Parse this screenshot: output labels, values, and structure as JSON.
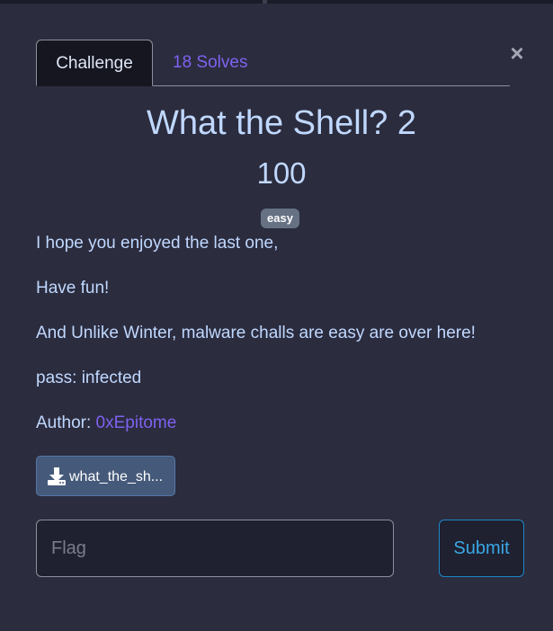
{
  "modal": {
    "close_label": "×",
    "tabs": [
      {
        "label": "Challenge"
      },
      {
        "label": "18 Solves"
      }
    ],
    "challenge": {
      "name": "What the Shell? 2",
      "value": "100",
      "tag": "easy",
      "description": [
        "I hope you enjoyed the last one,",
        "Have fun!",
        "And Unlike Winter, malware challs are easy are over here!",
        "pass: infected"
      ],
      "author_label": "Author: ",
      "author_name": "0xEpitome"
    },
    "files": [
      {
        "name": "what_the_sh...",
        "icon": "download-icon"
      }
    ],
    "flag": {
      "placeholder": "Flag",
      "value": ""
    },
    "submit_label": "Submit"
  },
  "colors": {
    "background": "#2b2c3e",
    "text": "#c0d8ff",
    "accent": "#7e62f0",
    "submit": "#3aa8e6",
    "tag_bg": "#667184"
  }
}
